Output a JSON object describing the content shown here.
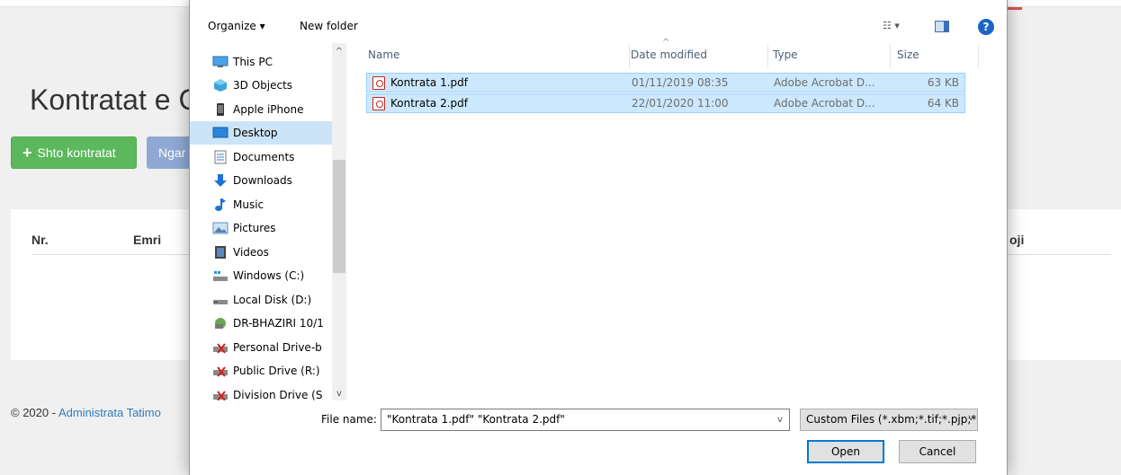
{
  "background_page": {
    "title": "Kontratat e C",
    "add_button": "Shto kontratat",
    "filter_button": "Ngar",
    "table_headers": {
      "nr": "Nr.",
      "emri": "Emri",
      "right": "oji"
    },
    "footer_prefix": "© 2020 - ",
    "footer_link": "Administrata Tatimo"
  },
  "dialog": {
    "toolbar": {
      "organize": "Organize ▾",
      "new_folder": "New folder",
      "help": "?"
    },
    "nav": {
      "items": [
        {
          "label": "This PC",
          "icon": "monitor-icon"
        },
        {
          "label": "3D Objects",
          "icon": "cube-icon"
        },
        {
          "label": "Apple iPhone",
          "icon": "phone-icon"
        },
        {
          "label": "Desktop",
          "icon": "desktop-icon"
        },
        {
          "label": "Documents",
          "icon": "document-icon"
        },
        {
          "label": "Downloads",
          "icon": "download-icon"
        },
        {
          "label": "Music",
          "icon": "music-icon"
        },
        {
          "label": "Pictures",
          "icon": "picture-icon"
        },
        {
          "label": "Videos",
          "icon": "video-icon"
        },
        {
          "label": "Windows (C:)",
          "icon": "drive-icon"
        },
        {
          "label": "Local Disk (D:)",
          "icon": "drive-icon"
        },
        {
          "label": "DR-BHAZIRI 10/1",
          "icon": "network-icon"
        },
        {
          "label": "Personal Drive-b",
          "icon": "network-drive-icon"
        },
        {
          "label": "Public Drive (R:)",
          "icon": "network-drive-icon"
        },
        {
          "label": "Division Drive (S",
          "icon": "network-drive-icon"
        }
      ],
      "selected": "Desktop"
    },
    "columns": {
      "name": "Name",
      "date_modified": "Date modified",
      "type": "Type",
      "size": "Size"
    },
    "files": [
      {
        "name": "Kontrata 1.pdf",
        "date": "01/11/2019 08:35",
        "type": "Adobe Acrobat D...",
        "size": "63 KB"
      },
      {
        "name": "Kontrata 2.pdf",
        "date": "22/01/2020 11:00",
        "type": "Adobe Acrobat D...",
        "size": "64 KB"
      }
    ],
    "file_name_label": "File name:",
    "file_name_value": "\"Kontrata 1.pdf\" \"Kontrata 2.pdf\"",
    "file_type_filter": "Custom Files (*.xbm;*.tif;*.pjp;*",
    "open_button": "Open",
    "cancel_button": "Cancel"
  }
}
